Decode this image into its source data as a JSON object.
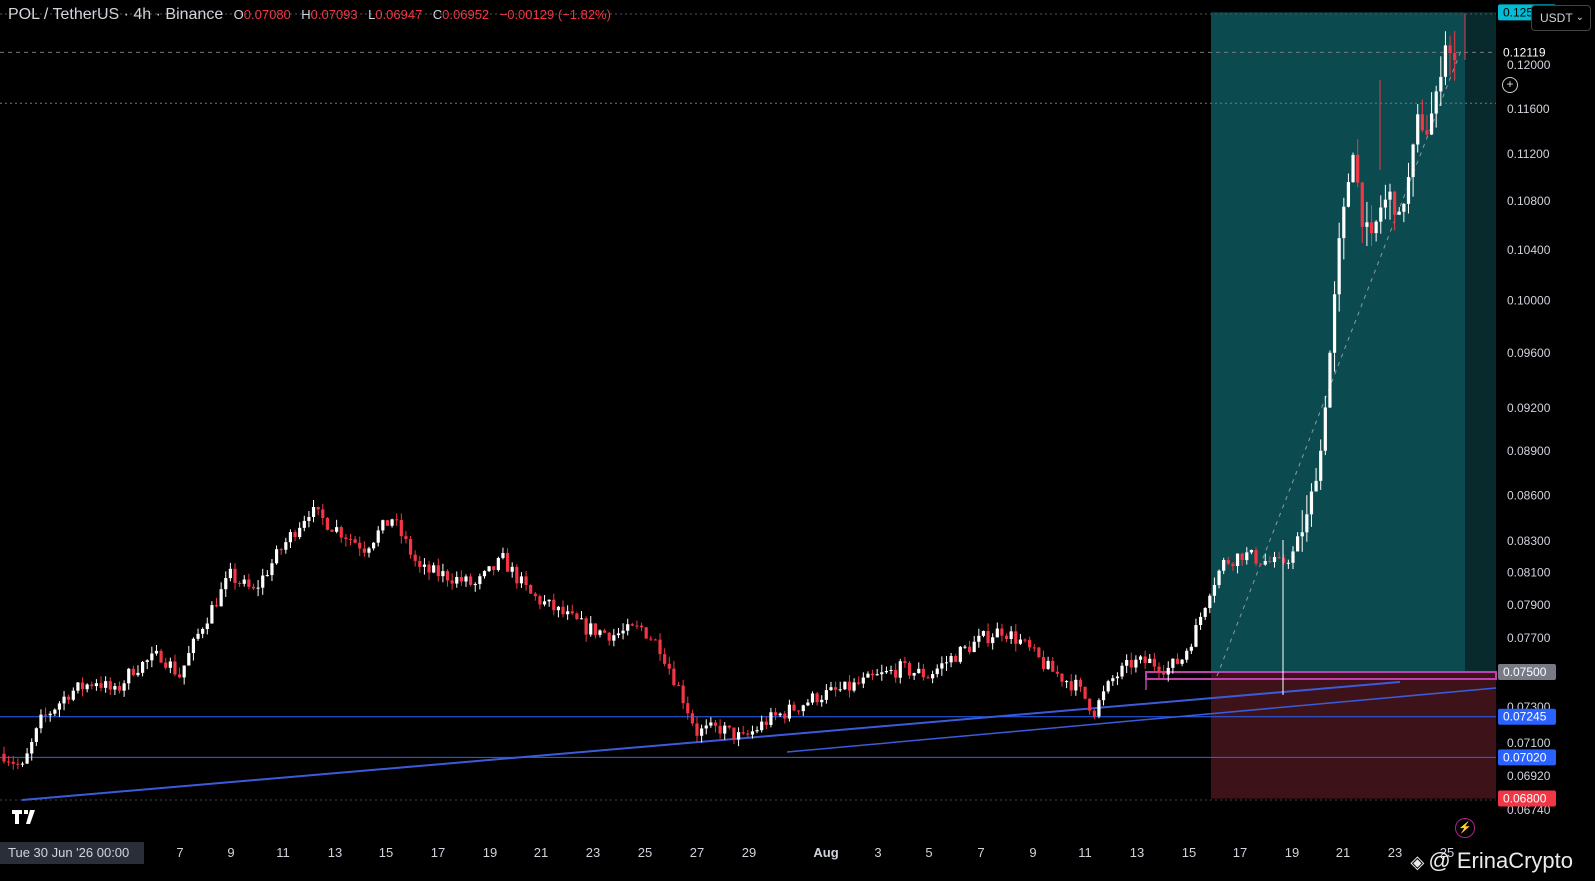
{
  "header": {
    "symbol": "POL / TetherUS · 4h · Binance",
    "o_label": "O",
    "o": "0.07080",
    "h_label": "H",
    "h": "0.07093",
    "l_label": "L",
    "l": "0.06947",
    "c_label": "C",
    "c": "0.06952",
    "change": "−0.00129 (−1.82%)"
  },
  "currency_selector": "USDT",
  "date_plate": "Tue 30 Jun '26   00:00",
  "watermark": "@ ErinaCrypto",
  "colors": {
    "up": "#ffffff",
    "down": "#f23645",
    "profit_zone": "#0b4b50",
    "loss_zone": "#3d1319",
    "hline": "#2962ff",
    "trend": "#3b5bdb",
    "pink": "#c040b0"
  },
  "chart_data": {
    "type": "candlestick",
    "title": "POL / TetherUS · 4h · Binance",
    "y_scale": "log",
    "ylim": [
      0.0674,
      0.1262
    ],
    "y_ticks": [
      "0.12000",
      "0.11600",
      "0.11200",
      "0.10800",
      "0.10400",
      "0.10000",
      "0.09600",
      "0.09200",
      "0.08900",
      "0.08600",
      "0.08300",
      "0.08100",
      "0.07900",
      "0.07700",
      "0.07300",
      "0.07100",
      "0.06920",
      "0.06740"
    ],
    "x_ticks": [
      "7",
      "9",
      "11",
      "13",
      "15",
      "17",
      "19",
      "21",
      "23",
      "25",
      "27",
      "29",
      "Aug",
      "3",
      "5",
      "7",
      "9",
      "11",
      "13",
      "15",
      "17",
      "19",
      "21",
      "23",
      "25"
    ],
    "price_tags": [
      {
        "label": "0.12500",
        "color": "#00bcd4",
        "text_color": "#000000"
      },
      {
        "label": "0.12119",
        "color": "#000000",
        "text_color": "#ffffff"
      },
      {
        "label": "0.07500",
        "color": "#787b86",
        "text_color": "#ffffff"
      },
      {
        "label": "0.07245",
        "color": "#2962ff",
        "text_color": "#ffffff"
      },
      {
        "label": "0.07020",
        "color": "#2962ff",
        "text_color": "#ffffff"
      },
      {
        "label": "0.06800",
        "color": "#f23645",
        "text_color": "#ffffff"
      }
    ],
    "price_tag_values": [
      0.125,
      0.12119,
      0.075,
      0.07245,
      0.0702,
      0.068
    ],
    "horizontal_lines": [
      0.07245,
      0.0702
    ],
    "position": {
      "entry": 0.075,
      "target": 0.125,
      "stop": 0.068
    },
    "close_path": [
      [
        0,
        0.0704
      ],
      [
        4,
        0.0696
      ],
      [
        8,
        0.0722
      ],
      [
        14,
        0.0738
      ],
      [
        20,
        0.0745
      ],
      [
        24,
        0.0738
      ],
      [
        28,
        0.0752
      ],
      [
        34,
        0.076
      ],
      [
        38,
        0.0748
      ],
      [
        43,
        0.0778
      ],
      [
        49,
        0.0808
      ],
      [
        54,
        0.0798
      ],
      [
        60,
        0.0825
      ],
      [
        66,
        0.085
      ],
      [
        72,
        0.0838
      ],
      [
        78,
        0.0826
      ],
      [
        84,
        0.0845
      ],
      [
        90,
        0.0812
      ],
      [
        96,
        0.0808
      ],
      [
        102,
        0.0802
      ],
      [
        108,
        0.0818
      ],
      [
        114,
        0.0796
      ],
      [
        120,
        0.0786
      ],
      [
        126,
        0.0776
      ],
      [
        132,
        0.0772
      ],
      [
        138,
        0.0776
      ],
      [
        142,
        0.0765
      ],
      [
        147,
        0.0735
      ],
      [
        150,
        0.0716
      ],
      [
        155,
        0.0718
      ],
      [
        160,
        0.0712
      ],
      [
        165,
        0.0722
      ],
      [
        170,
        0.0728
      ],
      [
        176,
        0.0736
      ],
      [
        182,
        0.074
      ],
      [
        188,
        0.0746
      ],
      [
        194,
        0.0752
      ],
      [
        200,
        0.0748
      ],
      [
        206,
        0.076
      ],
      [
        212,
        0.077
      ],
      [
        216,
        0.0775
      ],
      [
        220,
        0.0768
      ],
      [
        226,
        0.0752
      ],
      [
        232,
        0.0742
      ],
      [
        236,
        0.0728
      ],
      [
        240,
        0.0746
      ],
      [
        244,
        0.0755
      ],
      [
        248,
        0.0756
      ],
      [
        252,
        0.0752
      ],
      [
        255,
        0.0758
      ],
      [
        258,
        0.0775
      ],
      [
        261,
        0.08
      ],
      [
        264,
        0.0816
      ],
      [
        268,
        0.0822
      ],
      [
        272,
        0.0818
      ],
      [
        276,
        0.0815
      ],
      [
        279,
        0.0822
      ],
      [
        282,
        0.0845
      ],
      [
        285,
        0.089
      ],
      [
        287,
        0.096
      ],
      [
        289,
        0.1045
      ],
      [
        292,
        0.1125
      ],
      [
        294,
        0.1065
      ],
      [
        296,
        0.1048
      ],
      [
        298,
        0.1075
      ],
      [
        300,
        0.1085
      ],
      [
        302,
        0.1065
      ],
      [
        304,
        0.1098
      ],
      [
        306,
        0.115
      ],
      [
        308,
        0.114
      ],
      [
        310,
        0.117
      ],
      [
        312,
        0.1222
      ],
      [
        314,
        0.12
      ]
    ]
  }
}
